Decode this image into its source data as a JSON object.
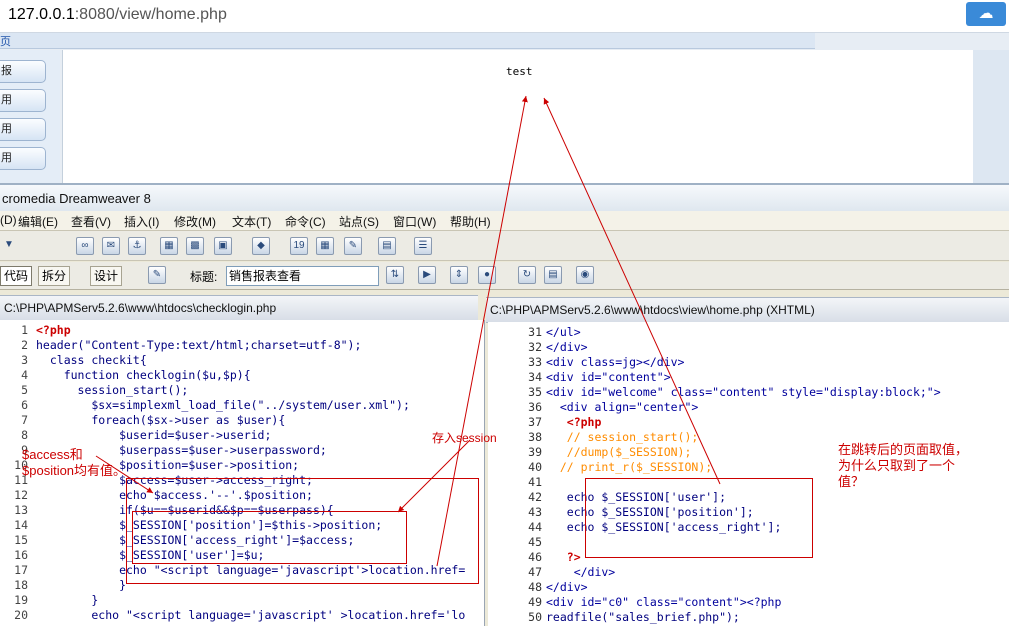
{
  "browser": {
    "url_host": "127.0.0.1",
    "url_rest": ":8080/view/home.php",
    "page_tab": "页",
    "nav_items": [
      "报",
      "用",
      "用",
      "用"
    ],
    "content_text": "test"
  },
  "dw": {
    "window_title": "cromedia Dreamweaver 8",
    "menu": [
      "(D)",
      "编辑(E)",
      "查看(V)",
      "插入(I)",
      "修改(M)",
      "文本(T)",
      "命令(C)",
      "站点(S)",
      "窗口(W)",
      "帮助(H)"
    ],
    "view_buttons": {
      "code": "代码",
      "split": "拆分",
      "design": "设计"
    },
    "title_label": "标题:",
    "title_value": "销售报表查看",
    "left_path": "C:\\PHP\\APMServ5.2.6\\www\\htdocs\\checklogin.php",
    "right_path": "C:\\PHP\\APMServ5.2.6\\www\\htdocs\\view\\home.php (XHTML)"
  },
  "left_code": [
    {
      "n": "1",
      "t": "<?php"
    },
    {
      "n": "2",
      "t": "header(\"Content-Type:text/html;charset=utf-8\");"
    },
    {
      "n": "3",
      "t": "  class checkit{"
    },
    {
      "n": "4",
      "t": "    function checklogin($u,$p){"
    },
    {
      "n": "5",
      "t": "      session_start();"
    },
    {
      "n": "6",
      "t": "        $sx=simplexml_load_file(\"../system/user.xml\");"
    },
    {
      "n": "7",
      "t": "        foreach($sx->user as $user){"
    },
    {
      "n": "8",
      "t": "            $userid=$user->userid;"
    },
    {
      "n": "9",
      "t": "            $userpass=$user->userpassword;"
    },
    {
      "n": "10",
      "t": "            $position=$user->position;"
    },
    {
      "n": "11",
      "t": "            $access=$user->access_right;"
    },
    {
      "n": "12",
      "t": "            echo $access.'--'.$position;"
    },
    {
      "n": "13",
      "t": "            if($u==$userid&&$p==$userpass){"
    },
    {
      "n": "14",
      "t": "            $_SESSION['position']=$this->position;"
    },
    {
      "n": "15",
      "t": "            $_SESSION['access_right']=$access;"
    },
    {
      "n": "16",
      "t": "            $_SESSION['user']=$u;"
    },
    {
      "n": "17",
      "t": "            echo \"<script language='javascript'>location.href="
    },
    {
      "n": "18",
      "t": "            }"
    },
    {
      "n": "19",
      "t": "        }"
    },
    {
      "n": "20",
      "t": "        echo \"<script language='javascript' >location.href='lo"
    }
  ],
  "right_code": [
    {
      "n": "31",
      "t": "</ul>"
    },
    {
      "n": "32",
      "t": "</div>"
    },
    {
      "n": "33",
      "t": "<div class=jg></div>"
    },
    {
      "n": "34",
      "t": "<div id=\"content\">"
    },
    {
      "n": "35",
      "t": "<div id=\"welcome\" class=\"content\" style=\"display:block;\">"
    },
    {
      "n": "36",
      "t": "  <div align=\"center\">"
    },
    {
      "n": "37",
      "t": "   <?php"
    },
    {
      "n": "38",
      "t": "   // session_start();"
    },
    {
      "n": "39",
      "t": "   //dump($_SESSION);"
    },
    {
      "n": "40",
      "t": "  // print_r($_SESSION);"
    },
    {
      "n": "41",
      "t": ""
    },
    {
      "n": "42",
      "t": "   echo $_SESSION['user'];"
    },
    {
      "n": "43",
      "t": "   echo $_SESSION['position'];"
    },
    {
      "n": "44",
      "t": "   echo $_SESSION['access_right'];"
    },
    {
      "n": "45",
      "t": ""
    },
    {
      "n": "46",
      "t": "   ?>"
    },
    {
      "n": "47",
      "t": "    </div>"
    },
    {
      "n": "48",
      "t": "</div>"
    },
    {
      "n": "49",
      "t": "<div id=\"c0\" class=\"content\"><?php"
    },
    {
      "n": "50",
      "t": "readfile(\"sales_brief.php\");"
    }
  ],
  "annotations": {
    "save_session": "存入session",
    "left_note": "$access和\n$position均有值。",
    "right_note": "在跳转后的页面取值，\n为什么只取到了一个\n值？"
  }
}
